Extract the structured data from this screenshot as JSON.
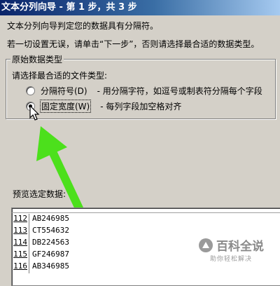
{
  "window": {
    "title": "文本分列向导 - 第 1 步，共 3 步"
  },
  "intro": {
    "line1": "文本分列向导判定您的数据具有分隔符。",
    "line2": "若一切设置无误，请单击“下一步”，否则请选择最合适的数据类型。"
  },
  "group": {
    "title": "原始数据类型",
    "prompt": "请选择最合适的文件类型:",
    "options": [
      {
        "label": "分隔符号(D)",
        "desc": "- 用分隔字符，如逗号或制表符分隔每个字段",
        "checked": false
      },
      {
        "label": "固定宽度(W)",
        "desc": "- 每列字段加空格对齐",
        "checked": true
      }
    ]
  },
  "preview": {
    "title": "预览选定数据:",
    "rows": [
      {
        "num": "112",
        "value": "AB246985"
      },
      {
        "num": "113",
        "value": "CT554632"
      },
      {
        "num": "114",
        "value": "DB224563"
      },
      {
        "num": "115",
        "value": "GF246987"
      },
      {
        "num": "116",
        "value": "AB346985"
      }
    ]
  },
  "watermark": {
    "logo": "百科全说",
    "tagline": "助你轻松解决"
  },
  "colors": {
    "arrow": "#4ce01c",
    "title_bar": "#0a246a"
  }
}
